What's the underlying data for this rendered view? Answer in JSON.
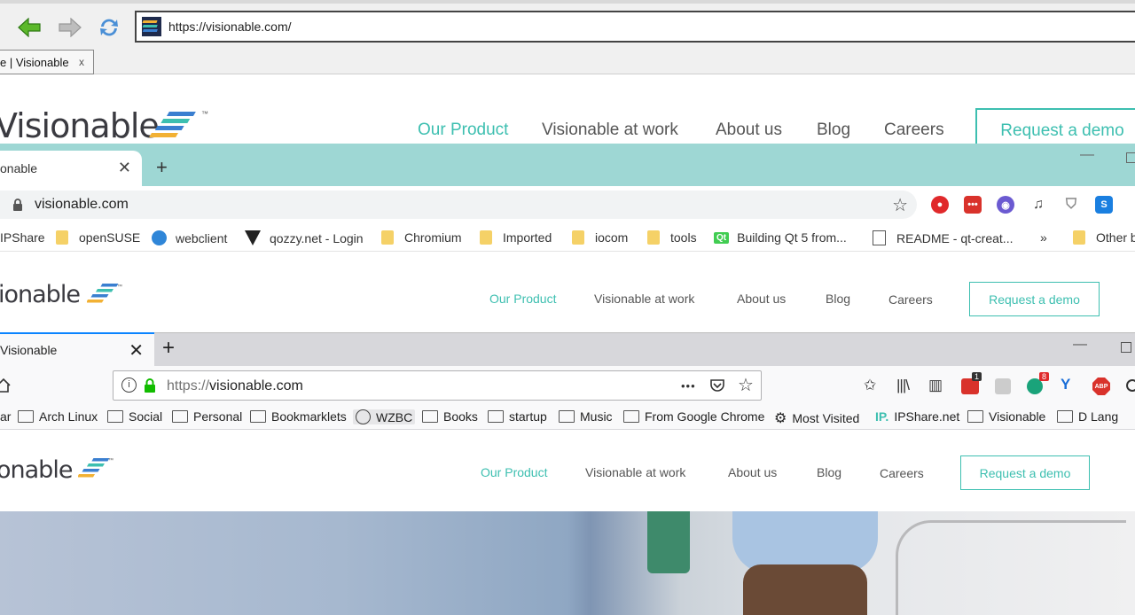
{
  "colors": {
    "accent": "#3dbfb0",
    "chrome_tabbar": "#9ed7d4",
    "firefox_tab_accent": "#0a84ff"
  },
  "browser1": {
    "url": "https://visionable.com/",
    "tab_title": "e | Visionable",
    "tab_close": "x"
  },
  "browser2": {
    "tab_title": "onable",
    "tab_close": "✕",
    "new_tab": "+",
    "minimize": "—",
    "address": "visionable.com",
    "bookmarks": [
      {
        "label": "IPShare",
        "icon": "ip-icon"
      },
      {
        "label": "openSUSE",
        "icon": "folder-icon"
      },
      {
        "label": "webclient",
        "icon": "webclient-icon"
      },
      {
        "label": "qozzy.net - Login",
        "icon": "qozzy-icon"
      },
      {
        "label": "Chromium",
        "icon": "folder-icon"
      },
      {
        "label": "Imported",
        "icon": "folder-icon"
      },
      {
        "label": "iocom",
        "icon": "folder-icon"
      },
      {
        "label": "tools",
        "icon": "folder-icon"
      },
      {
        "label": "Building Qt 5 from...",
        "icon": "qt-icon"
      },
      {
        "label": "README - qt-creat...",
        "icon": "readme-icon"
      },
      {
        "label": "»",
        "icon": "overflow"
      },
      {
        "label": "Other b",
        "icon": "folder-icon"
      }
    ],
    "qt_badge": "Qt",
    "s_badge": "S"
  },
  "browser3": {
    "tab_title": "Visionable",
    "tab_close": "✕",
    "new_tab": "+",
    "minimize": "—",
    "url_prefix": "https://",
    "url_host": "visionable.com",
    "toolbar_more": "•••",
    "badge_1": "1",
    "badge_8": "8",
    "abp_label": "ABP",
    "bookmarks": [
      {
        "label": "ar",
        "icon": "none"
      },
      {
        "label": "Arch Linux",
        "icon": "folder-icon"
      },
      {
        "label": "Social",
        "icon": "folder-icon"
      },
      {
        "label": "Personal",
        "icon": "folder-icon"
      },
      {
        "label": "Bookmarklets",
        "icon": "folder-icon"
      },
      {
        "label": "WZBC",
        "icon": "globe-icon"
      },
      {
        "label": "Books",
        "icon": "folder-icon"
      },
      {
        "label": "startup",
        "icon": "folder-icon"
      },
      {
        "label": "Music",
        "icon": "folder-icon"
      },
      {
        "label": "From Google Chrome",
        "icon": "folder-icon"
      },
      {
        "label": "Most Visited",
        "icon": "gear-icon"
      },
      {
        "label": "IPShare.net",
        "icon": "ip-icon"
      },
      {
        "label": "Visionable",
        "icon": "folder-icon"
      },
      {
        "label": "D Lang",
        "icon": "folder-icon"
      }
    ],
    "ip_glyph": "IP."
  },
  "site": {
    "brand_full": "Visionable",
    "brand_cut": "ionable",
    "brand_cut3": "onable",
    "trademark": "™",
    "nav": [
      "Our Product",
      "Visionable at work",
      "About us",
      "Blog",
      "Careers"
    ],
    "cta": "Request a demo"
  }
}
